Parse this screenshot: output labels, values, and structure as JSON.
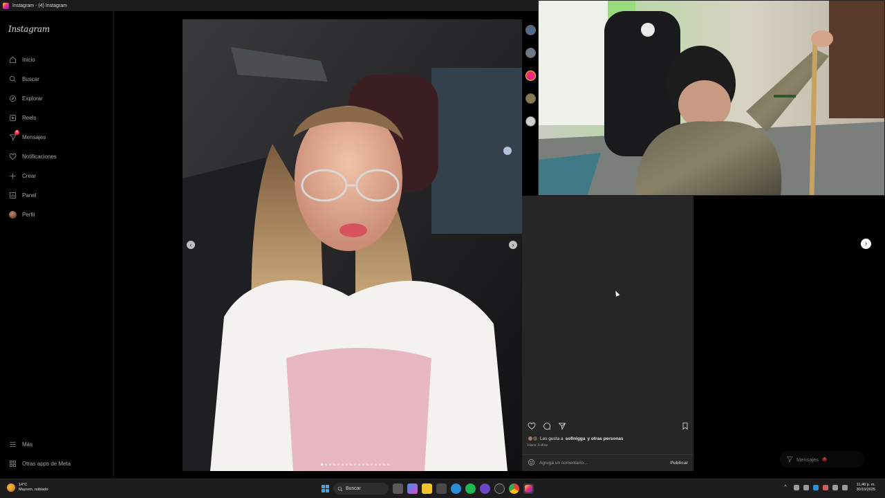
{
  "window": {
    "title": "Instagram - (4) Instagram"
  },
  "sidebar": {
    "logo": "Instagram",
    "items": [
      {
        "label": "Inicio",
        "icon": "home-icon"
      },
      {
        "label": "Buscar",
        "icon": "search-icon"
      },
      {
        "label": "Explorar",
        "icon": "compass-icon"
      },
      {
        "label": "Reels",
        "icon": "reels-icon"
      },
      {
        "label": "Mensajes",
        "icon": "messenger-icon",
        "badge": "4"
      },
      {
        "label": "Notificaciones",
        "icon": "heart-icon"
      },
      {
        "label": "Crear",
        "icon": "plus-icon"
      },
      {
        "label": "Panel",
        "icon": "dashboard-icon"
      },
      {
        "label": "Perfil",
        "icon": "avatar"
      }
    ],
    "bottom": [
      {
        "label": "Más",
        "icon": "menu-icon"
      },
      {
        "label": "Otras apps de Meta",
        "icon": "meta-icon"
      }
    ]
  },
  "post": {
    "carousel": {
      "slide_count": 17,
      "active_index": 0
    },
    "likes_prefix": "Les gusta a",
    "likes_user": "sofinigga",
    "likes_suffix": "y otras personas",
    "time": "Hace 3 días",
    "comment_placeholder": "Agrega un comentario...",
    "publish_label": "Publicar"
  },
  "messages_pill": {
    "label": "Mensajes",
    "badge": "4"
  },
  "taskbar": {
    "weather_temp": "14°C",
    "weather_desc": "Mayorm. nublado",
    "search_label": "Buscar",
    "time": "11:40 p. m.",
    "date": "30/10/2025"
  },
  "colors": {
    "background": "#000000",
    "panel": "#262626",
    "story_gradient": [
      "#f9ce34",
      "#ee2a7b",
      "#6228d7"
    ],
    "badge": "#ff3040"
  }
}
